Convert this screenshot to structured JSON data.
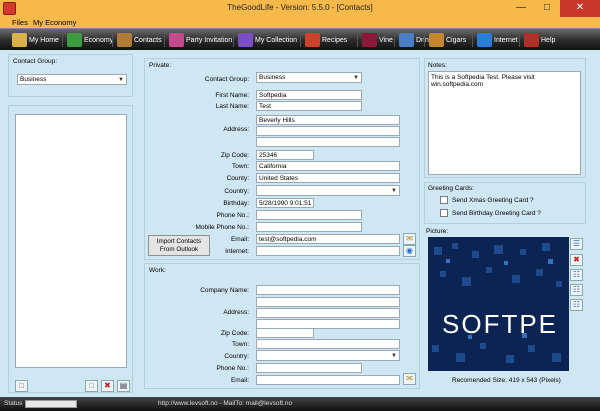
{
  "window": {
    "title": "TheGoodLife  -  Version: 5.5.0 - [Contacts]"
  },
  "menu": {
    "items": [
      "Files",
      "My Economy"
    ]
  },
  "toolbar": {
    "buttons": [
      {
        "label": "My Home",
        "icon": "house-icon",
        "color": "#d9b24c"
      },
      {
        "label": "Economy",
        "icon": "money-icon",
        "color": "#3f9b3f"
      },
      {
        "label": "Contacts",
        "icon": "contacts-icon",
        "color": "#b07a3a"
      },
      {
        "label": "Party Invitation",
        "icon": "party-icon",
        "color": "#c44a8e"
      },
      {
        "label": "My Collection",
        "icon": "books-icon",
        "color": "#7a4fc4"
      },
      {
        "label": "Recipes",
        "icon": "recipes-icon",
        "color": "#c9432d"
      },
      {
        "label": "Vine",
        "icon": "wine-icon",
        "color": "#8b1a3a"
      },
      {
        "label": "Drinks",
        "icon": "drinks-icon",
        "color": "#4a7fc4"
      },
      {
        "label": "Cigars",
        "icon": "cigars-icon",
        "color": "#c4862e"
      },
      {
        "label": "Internet",
        "icon": "globe-icon",
        "color": "#2a7fd4"
      },
      {
        "label": "Help",
        "icon": "help-icon",
        "color": "#b0302a"
      }
    ]
  },
  "left": {
    "contact_group_label": "Contact Group:",
    "contact_group_value": "Business"
  },
  "private": {
    "section_label": "Private:",
    "contact_group_label": "Contact Group:",
    "contact_group_value": "Business",
    "first_name_label": "First Name:",
    "first_name_value": "Softpedia",
    "last_name_label": "Last Name:",
    "last_name_value": "Test",
    "address_label": "Address:",
    "address_line1": "Beverly Hills",
    "address_line2": "",
    "address_line3": "",
    "zip_label": "Zip Code:",
    "zip_value": "25346",
    "town_label": "Town:",
    "town_value": "California",
    "county_label": "County:",
    "county_value": "United States",
    "country_label": "Country:",
    "country_value": "",
    "birthday_label": "Birthday:",
    "birthday_value": "5/28/1990 9:01:51 AM",
    "phone_label": "Phone No.:",
    "phone_value": "",
    "mobile_label": "Mobile Phone No.:",
    "mobile_value": "",
    "email_label": "Email:",
    "email_value": "test@softpedia.com",
    "internet_label": "Internet:",
    "internet_value": "",
    "import_button": "Import Contacts From Outlook"
  },
  "work": {
    "section_label": "Work:",
    "company_label": "Company Name:",
    "company_value": "",
    "address_label": "Address:",
    "zip_label": "Zip Code:",
    "town_label": "Town:",
    "country_label": "Country:",
    "phone_label": "Phone No.:",
    "email_label": "Email:"
  },
  "notes": {
    "label": "Notes:",
    "text": "This is a Softpedia Test. Please visit win.softpedia.com"
  },
  "greeting": {
    "label": "Greeting Cards:",
    "xmas": "Send Xmas Greeting Card ?",
    "birthday": "Send Birthday Greeting Card ?"
  },
  "picture": {
    "label": "Picture:",
    "logo_text": "SOFTPE",
    "recommended": "Recomended Size:  419 x 543 (Pixels)"
  },
  "status": {
    "label": "Status",
    "links": "http://www.levsoft.no  -  MailTo: mail@levsoft.no"
  }
}
